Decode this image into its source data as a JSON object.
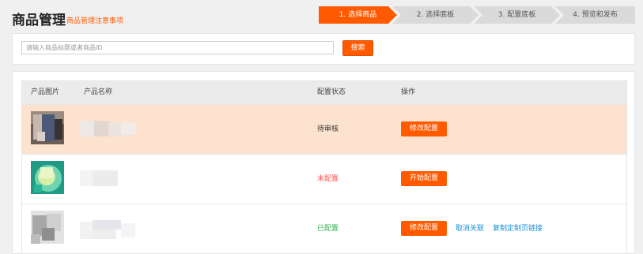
{
  "header": {
    "title": "商品管理",
    "notes_link": "商品管理注意事项",
    "steps": [
      {
        "label": "1. 选择商品",
        "active": true
      },
      {
        "label": "2. 选择底板",
        "active": false
      },
      {
        "label": "3. 配置底板",
        "active": false
      },
      {
        "label": "4. 预览和发布",
        "active": false
      }
    ]
  },
  "search": {
    "placeholder": "请输入商品标题或者商品ID",
    "button_label": "搜索"
  },
  "table": {
    "columns": [
      "产品图片",
      "产品名称",
      "配置状态",
      "操作"
    ],
    "rows": [
      {
        "status": "待审核",
        "status_color": "#333333",
        "action": "修改配置",
        "links": [],
        "highlighted": true
      },
      {
        "status": "未配置",
        "status_color": "#ff4d4d",
        "action": "开始配置",
        "links": [],
        "highlighted": false
      },
      {
        "status": "已配置",
        "status_color": "#2fb34a",
        "action": "修改配置",
        "links": [
          "取消关联",
          "复制定制页链接"
        ],
        "highlighted": false
      }
    ]
  },
  "colors": {
    "accent": "#ff5a00",
    "link": "#1a8fd8",
    "highlight_row": "#fde3cf"
  }
}
